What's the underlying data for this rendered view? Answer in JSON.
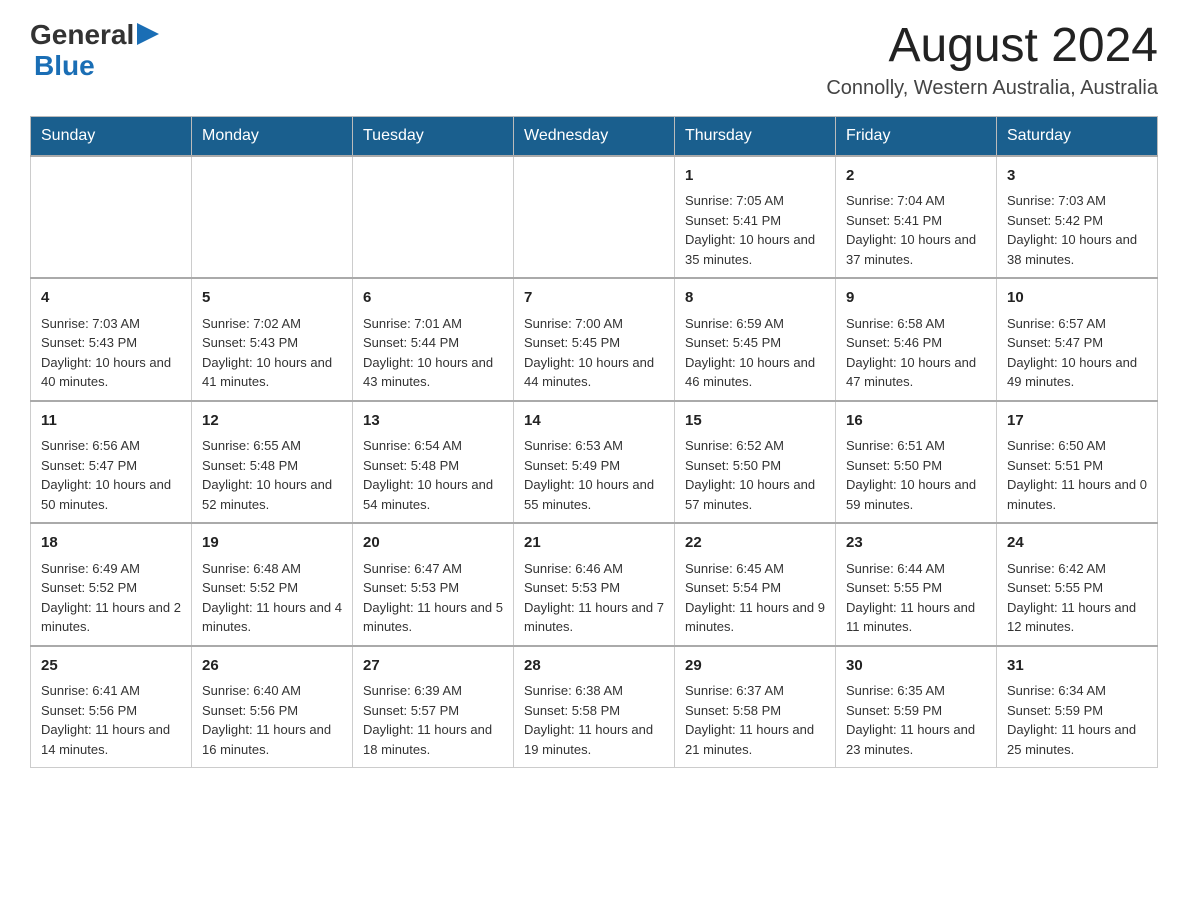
{
  "header": {
    "logo_general": "General",
    "logo_blue": "Blue",
    "month_year": "August 2024",
    "location": "Connolly, Western Australia, Australia"
  },
  "days_of_week": [
    "Sunday",
    "Monday",
    "Tuesday",
    "Wednesday",
    "Thursday",
    "Friday",
    "Saturday"
  ],
  "weeks": [
    [
      {
        "day": "",
        "sunrise": "",
        "sunset": "",
        "daylight": ""
      },
      {
        "day": "",
        "sunrise": "",
        "sunset": "",
        "daylight": ""
      },
      {
        "day": "",
        "sunrise": "",
        "sunset": "",
        "daylight": ""
      },
      {
        "day": "",
        "sunrise": "",
        "sunset": "",
        "daylight": ""
      },
      {
        "day": "1",
        "sunrise": "Sunrise: 7:05 AM",
        "sunset": "Sunset: 5:41 PM",
        "daylight": "Daylight: 10 hours and 35 minutes."
      },
      {
        "day": "2",
        "sunrise": "Sunrise: 7:04 AM",
        "sunset": "Sunset: 5:41 PM",
        "daylight": "Daylight: 10 hours and 37 minutes."
      },
      {
        "day": "3",
        "sunrise": "Sunrise: 7:03 AM",
        "sunset": "Sunset: 5:42 PM",
        "daylight": "Daylight: 10 hours and 38 minutes."
      }
    ],
    [
      {
        "day": "4",
        "sunrise": "Sunrise: 7:03 AM",
        "sunset": "Sunset: 5:43 PM",
        "daylight": "Daylight: 10 hours and 40 minutes."
      },
      {
        "day": "5",
        "sunrise": "Sunrise: 7:02 AM",
        "sunset": "Sunset: 5:43 PM",
        "daylight": "Daylight: 10 hours and 41 minutes."
      },
      {
        "day": "6",
        "sunrise": "Sunrise: 7:01 AM",
        "sunset": "Sunset: 5:44 PM",
        "daylight": "Daylight: 10 hours and 43 minutes."
      },
      {
        "day": "7",
        "sunrise": "Sunrise: 7:00 AM",
        "sunset": "Sunset: 5:45 PM",
        "daylight": "Daylight: 10 hours and 44 minutes."
      },
      {
        "day": "8",
        "sunrise": "Sunrise: 6:59 AM",
        "sunset": "Sunset: 5:45 PM",
        "daylight": "Daylight: 10 hours and 46 minutes."
      },
      {
        "day": "9",
        "sunrise": "Sunrise: 6:58 AM",
        "sunset": "Sunset: 5:46 PM",
        "daylight": "Daylight: 10 hours and 47 minutes."
      },
      {
        "day": "10",
        "sunrise": "Sunrise: 6:57 AM",
        "sunset": "Sunset: 5:47 PM",
        "daylight": "Daylight: 10 hours and 49 minutes."
      }
    ],
    [
      {
        "day": "11",
        "sunrise": "Sunrise: 6:56 AM",
        "sunset": "Sunset: 5:47 PM",
        "daylight": "Daylight: 10 hours and 50 minutes."
      },
      {
        "day": "12",
        "sunrise": "Sunrise: 6:55 AM",
        "sunset": "Sunset: 5:48 PM",
        "daylight": "Daylight: 10 hours and 52 minutes."
      },
      {
        "day": "13",
        "sunrise": "Sunrise: 6:54 AM",
        "sunset": "Sunset: 5:48 PM",
        "daylight": "Daylight: 10 hours and 54 minutes."
      },
      {
        "day": "14",
        "sunrise": "Sunrise: 6:53 AM",
        "sunset": "Sunset: 5:49 PM",
        "daylight": "Daylight: 10 hours and 55 minutes."
      },
      {
        "day": "15",
        "sunrise": "Sunrise: 6:52 AM",
        "sunset": "Sunset: 5:50 PM",
        "daylight": "Daylight: 10 hours and 57 minutes."
      },
      {
        "day": "16",
        "sunrise": "Sunrise: 6:51 AM",
        "sunset": "Sunset: 5:50 PM",
        "daylight": "Daylight: 10 hours and 59 minutes."
      },
      {
        "day": "17",
        "sunrise": "Sunrise: 6:50 AM",
        "sunset": "Sunset: 5:51 PM",
        "daylight": "Daylight: 11 hours and 0 minutes."
      }
    ],
    [
      {
        "day": "18",
        "sunrise": "Sunrise: 6:49 AM",
        "sunset": "Sunset: 5:52 PM",
        "daylight": "Daylight: 11 hours and 2 minutes."
      },
      {
        "day": "19",
        "sunrise": "Sunrise: 6:48 AM",
        "sunset": "Sunset: 5:52 PM",
        "daylight": "Daylight: 11 hours and 4 minutes."
      },
      {
        "day": "20",
        "sunrise": "Sunrise: 6:47 AM",
        "sunset": "Sunset: 5:53 PM",
        "daylight": "Daylight: 11 hours and 5 minutes."
      },
      {
        "day": "21",
        "sunrise": "Sunrise: 6:46 AM",
        "sunset": "Sunset: 5:53 PM",
        "daylight": "Daylight: 11 hours and 7 minutes."
      },
      {
        "day": "22",
        "sunrise": "Sunrise: 6:45 AM",
        "sunset": "Sunset: 5:54 PM",
        "daylight": "Daylight: 11 hours and 9 minutes."
      },
      {
        "day": "23",
        "sunrise": "Sunrise: 6:44 AM",
        "sunset": "Sunset: 5:55 PM",
        "daylight": "Daylight: 11 hours and 11 minutes."
      },
      {
        "day": "24",
        "sunrise": "Sunrise: 6:42 AM",
        "sunset": "Sunset: 5:55 PM",
        "daylight": "Daylight: 11 hours and 12 minutes."
      }
    ],
    [
      {
        "day": "25",
        "sunrise": "Sunrise: 6:41 AM",
        "sunset": "Sunset: 5:56 PM",
        "daylight": "Daylight: 11 hours and 14 minutes."
      },
      {
        "day": "26",
        "sunrise": "Sunrise: 6:40 AM",
        "sunset": "Sunset: 5:56 PM",
        "daylight": "Daylight: 11 hours and 16 minutes."
      },
      {
        "day": "27",
        "sunrise": "Sunrise: 6:39 AM",
        "sunset": "Sunset: 5:57 PM",
        "daylight": "Daylight: 11 hours and 18 minutes."
      },
      {
        "day": "28",
        "sunrise": "Sunrise: 6:38 AM",
        "sunset": "Sunset: 5:58 PM",
        "daylight": "Daylight: 11 hours and 19 minutes."
      },
      {
        "day": "29",
        "sunrise": "Sunrise: 6:37 AM",
        "sunset": "Sunset: 5:58 PM",
        "daylight": "Daylight: 11 hours and 21 minutes."
      },
      {
        "day": "30",
        "sunrise": "Sunrise: 6:35 AM",
        "sunset": "Sunset: 5:59 PM",
        "daylight": "Daylight: 11 hours and 23 minutes."
      },
      {
        "day": "31",
        "sunrise": "Sunrise: 6:34 AM",
        "sunset": "Sunset: 5:59 PM",
        "daylight": "Daylight: 11 hours and 25 minutes."
      }
    ]
  ]
}
